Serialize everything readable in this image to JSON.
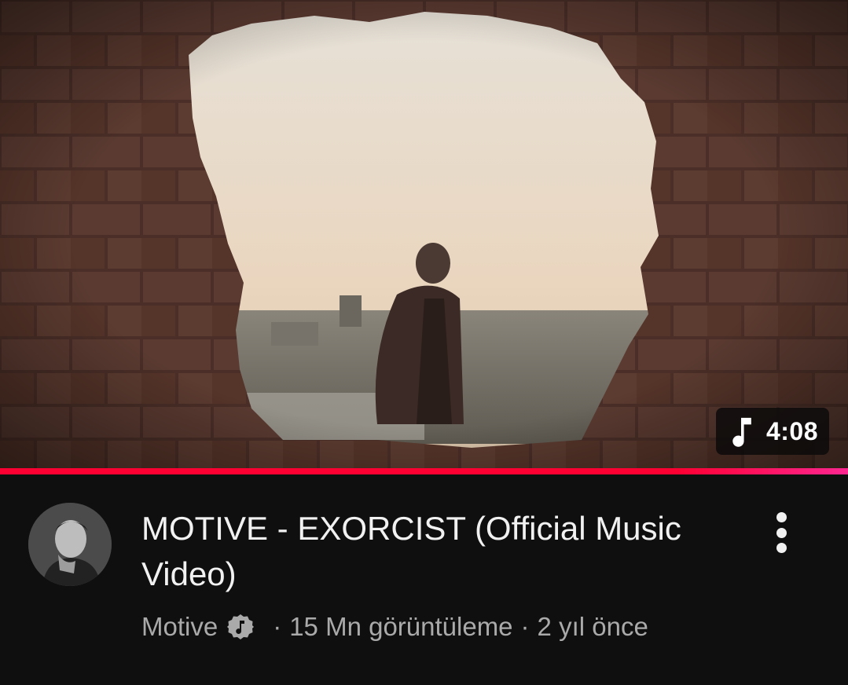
{
  "video": {
    "title": "MOTIVE - EXORCIST (Official Music Video)",
    "duration": "4:08",
    "progress_fraction": 1.0
  },
  "channel": {
    "name": "Motive",
    "verified_icon": "verified-music-note-icon"
  },
  "stats": {
    "separator": "·",
    "views": "15 Mn görüntüleme",
    "age": "2 yıl önce"
  },
  "icons": {
    "duration_badge": "music-note-icon",
    "menu": "more-vertical-icon"
  },
  "colors": {
    "background": "#0f0f0f",
    "progress_red": "#ff0033",
    "progress_pink": "#ff2791",
    "title_text": "#f1f1f1",
    "secondary_text": "#aaaaaa"
  }
}
